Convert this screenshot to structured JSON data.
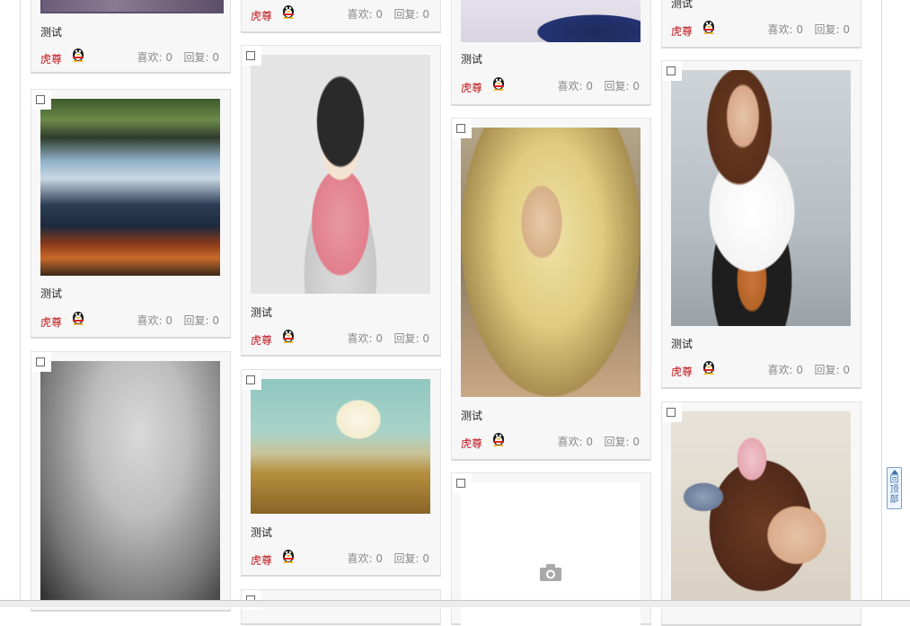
{
  "labels": {
    "author": "虎尊",
    "title": "测试",
    "likes": "喜欢: 0",
    "replies": "回复: 0"
  },
  "to_top": {
    "chars": [
      "回",
      "顶",
      "部"
    ]
  },
  "colors": {
    "author": "#c0141b",
    "meta": "#8a8a8a",
    "card_bg": "#f7f7f7",
    "link_blue": "#3e6fa6"
  },
  "cards": [
    {
      "column": 1,
      "title": "测试",
      "author": "虎尊",
      "likes": "喜欢: 0",
      "replies": "回复: 0",
      "image": "purple-photo-partial"
    },
    {
      "column": 1,
      "title": "测试",
      "author": "虎尊",
      "likes": "喜欢: 0",
      "replies": "回复: 0",
      "image": "waterfall-autumn"
    },
    {
      "column": 1,
      "title": "",
      "image": "bw-face-closeup"
    },
    {
      "column": 2,
      "title": "",
      "author": "虎尊",
      "likes": "喜欢: 0",
      "replies": "回复: 0",
      "image": ""
    },
    {
      "column": 2,
      "title": "测试",
      "author": "虎尊",
      "likes": "喜欢: 0",
      "replies": "回复: 0",
      "image": "kimono-doll-figure"
    },
    {
      "column": 2,
      "title": "测试",
      "author": "虎尊",
      "likes": "喜欢: 0",
      "replies": "回复: 0",
      "image": "wheat-field-cloud"
    },
    {
      "column": 3,
      "title": "测试",
      "author": "虎尊",
      "likes": "喜欢: 0",
      "replies": "回复: 0",
      "image": "necklace-partial"
    },
    {
      "column": 3,
      "title": "测试",
      "author": "虎尊",
      "likes": "喜欢: 0",
      "replies": "回复: 0",
      "image": "woman-lace-veil"
    },
    {
      "column": 3,
      "title": "",
      "image": "camera-placeholder"
    },
    {
      "column": 4,
      "title": "测试",
      "author": "虎尊",
      "likes": "喜欢: 0",
      "replies": "回复: 0",
      "image": ""
    },
    {
      "column": 4,
      "title": "测试",
      "author": "虎尊",
      "likes": "喜欢: 0",
      "replies": "回复: 0",
      "image": "woman-sunglasses-white-shirt"
    },
    {
      "column": 4,
      "title": "",
      "image": "woman-flower-hair"
    }
  ]
}
